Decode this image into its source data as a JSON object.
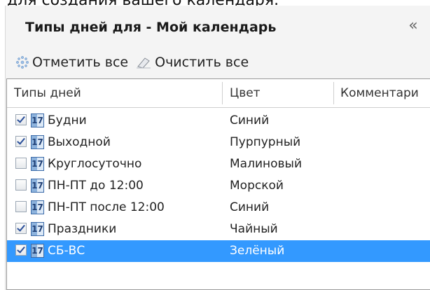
{
  "top_caption": "для создания вашего календаря.",
  "panel": {
    "title": "Типы дней для - Мой календарь",
    "collapse_glyph": "«"
  },
  "toolbar": {
    "select_all_label": "Отметить все",
    "clear_all_label": "Очистить все"
  },
  "grid": {
    "columns": [
      "Типы дней",
      "Цвет",
      "Комментари"
    ],
    "rows": [
      {
        "checked": true,
        "name": "Будни",
        "color": "Синий",
        "selected": false
      },
      {
        "checked": true,
        "name": "Выходной",
        "color": "Пурпурный",
        "selected": false
      },
      {
        "checked": false,
        "name": "Круглосуточно",
        "color": "Малиновый",
        "selected": false
      },
      {
        "checked": false,
        "name": "ПН-ПТ до 12:00",
        "color": "Морской",
        "selected": false
      },
      {
        "checked": false,
        "name": "ПН-ПТ после 12:00",
        "color": "Синий",
        "selected": false
      },
      {
        "checked": true,
        "name": "Праздники",
        "color": "Чайный",
        "selected": false
      },
      {
        "checked": true,
        "name": "СБ-ВС",
        "color": "Зелёный",
        "selected": true
      }
    ]
  },
  "icons": {
    "select_all": "sparkle-icon",
    "clear_all": "eraser-icon",
    "day_type": "calendar-icon",
    "collapse": "double-chevron-left-icon"
  },
  "colors": {
    "selection": "#3399ff",
    "panel_bg": "#f4f4f4"
  }
}
